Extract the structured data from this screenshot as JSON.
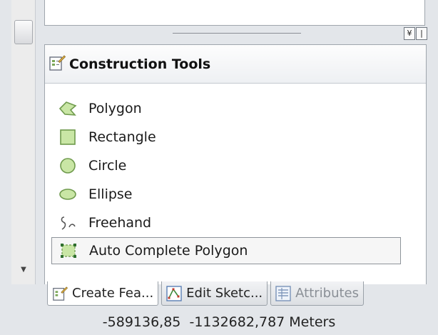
{
  "panel": {
    "title": "Construction Tools",
    "tools": [
      {
        "label": "Polygon",
        "icon": "polygon-icon"
      },
      {
        "label": "Rectangle",
        "icon": "rectangle-icon"
      },
      {
        "label": "Circle",
        "icon": "circle-icon"
      },
      {
        "label": "Ellipse",
        "icon": "ellipse-icon"
      },
      {
        "label": "Freehand",
        "icon": "freehand-icon"
      },
      {
        "label": "Auto Complete Polygon",
        "icon": "auto-complete-polygon-icon",
        "selected": true
      }
    ]
  },
  "toolbar": {
    "collapse_glyph": "¥",
    "pin_glyph": "|"
  },
  "tabs": [
    {
      "label": "Create Fea...",
      "icon": "create-features-icon",
      "active": true
    },
    {
      "label": "Edit Sketc...",
      "icon": "edit-sketch-icon",
      "active": false
    },
    {
      "label": "Attributes",
      "icon": "attributes-icon",
      "active": false,
      "disabled": true
    }
  ],
  "status": {
    "coordinates": "-589136,85  -1132682,787 Meters"
  },
  "colors": {
    "accent_green_fill": "#c9e6a5",
    "accent_green_stroke": "#6f9a4d",
    "background": "#e3e6ea"
  }
}
